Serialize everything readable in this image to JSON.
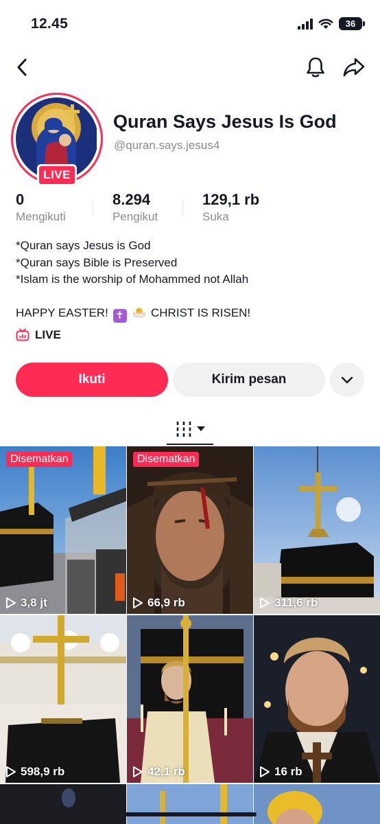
{
  "status": {
    "time": "12.45",
    "battery": "36"
  },
  "profile": {
    "display_name": "Quran Says Jesus Is God",
    "username": "@quran.says.jesus4",
    "live_badge": "LIVE"
  },
  "stats": [
    {
      "value": "0",
      "label": "Mengikuti"
    },
    {
      "value": "8.294",
      "label": "Pengikut"
    },
    {
      "value": "129,1 rb",
      "label": "Suka"
    }
  ],
  "bio": {
    "line1": "*Quran says Jesus is God",
    "line2": "*Quran says Bible is Preserved",
    "line3": "*Islam is the worship of Mohammed not Allah",
    "easter_start": "HAPPY EASTER!",
    "easter_end": "CHRIST IS RISEN!"
  },
  "live_link": "LIVE",
  "buttons": {
    "follow": "Ikuti",
    "message": "Kirim pesan"
  },
  "videos": [
    {
      "pinned": "Disematkan",
      "views": "3,8 jt"
    },
    {
      "pinned": "Disematkan",
      "views": "66,9 rb"
    },
    {
      "views": "311,6 rb"
    },
    {
      "views": "598,9 rb"
    },
    {
      "views": "42,1 rb"
    },
    {
      "views": "16 rb"
    }
  ],
  "colors": {
    "accent": "#fe2c55",
    "text": "#161823",
    "muted": "#8a8b91",
    "secondary_bg": "#f1f1f2"
  }
}
